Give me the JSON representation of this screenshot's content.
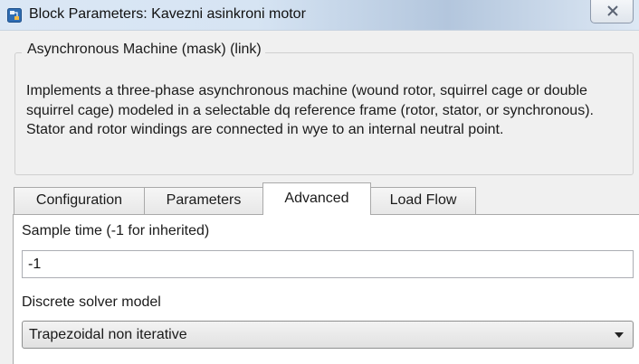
{
  "window": {
    "title": "Block Parameters: Kavezni asinkroni motor",
    "icon": "simulink-block-icon",
    "close_icon": "close-icon"
  },
  "mask": {
    "title": "Asynchronous Machine (mask) (link)",
    "description": "Implements a three-phase asynchronous machine (wound rotor, squirrel cage or double squirrel cage) modeled in a selectable dq reference frame (rotor, stator, or synchronous). Stator and rotor windings are connected in wye to an internal neutral point."
  },
  "tabs": [
    {
      "label": "Configuration",
      "active": false
    },
    {
      "label": "Parameters",
      "active": false
    },
    {
      "label": "Advanced",
      "active": true
    },
    {
      "label": "Load Flow",
      "active": false
    }
  ],
  "advanced": {
    "sample_time_label": "Sample time (-1 for inherited)",
    "sample_time_value": "-1",
    "solver_label": "Discrete solver model",
    "solver_value": "Trapezoidal non iterative"
  }
}
